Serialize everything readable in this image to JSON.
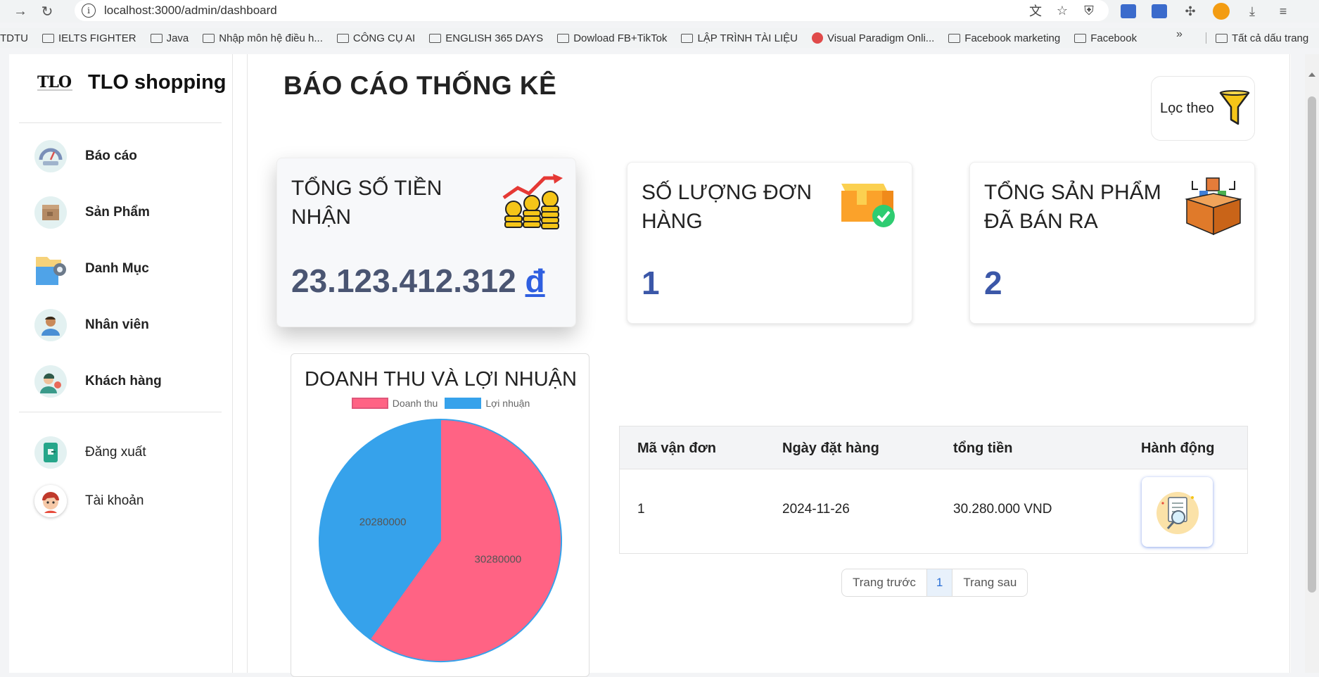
{
  "browser": {
    "url": "localhost:3000/admin/dashboard",
    "bookmarks": [
      "TDTU",
      "IELTS FIGHTER",
      "Java",
      "Nhập môn hệ điều h...",
      "CÔNG CỤ AI",
      "ENGLISH 365 DAYS",
      "Dowload FB+TikTok",
      "LẬP TRÌNH TÀI LIỆU",
      "Visual Paradigm Onli...",
      "Facebook marketing",
      "Facebook"
    ],
    "bookmarks_more": "»",
    "all_bookmarks": "Tất cả dấu trang"
  },
  "sidebar": {
    "brand_logo": "TLO",
    "brand_name": "TLO shopping",
    "items": [
      {
        "label": "Báo cáo",
        "icon": "report-gauge-icon"
      },
      {
        "label": "Sản Phẩm",
        "icon": "product-box-icon"
      },
      {
        "label": "Danh Mục",
        "icon": "category-folder-icon"
      },
      {
        "label": "Nhân viên",
        "icon": "employee-icon"
      },
      {
        "label": "Khách hàng",
        "icon": "customer-icon"
      }
    ],
    "bottom_items": [
      {
        "label": "Đăng xuất",
        "icon": "logout-icon"
      },
      {
        "label": "Tài khoản",
        "icon": "account-avatar-icon"
      }
    ]
  },
  "main": {
    "title": "BÁO CÁO THỐNG KÊ",
    "filter_label": "Lọc theo",
    "cards": [
      {
        "title": "TỔNG SỐ TIỀN NHẬN",
        "value": "23.123.412.312",
        "currency": "đ",
        "icon": "money-growth-icon"
      },
      {
        "title": "SỐ LƯỢNG ĐƠN HÀNG",
        "value": "1",
        "icon": "order-box-check-icon"
      },
      {
        "title": "TỔNG SẢN PHẨM ĐÃ BÁN RA",
        "value": "2",
        "icon": "products-sold-icon"
      }
    ],
    "table": {
      "headers": [
        "Mã vận đơn",
        "Ngày đặt hàng",
        "tổng tiền",
        "Hành động"
      ],
      "rows": [
        {
          "code": "1",
          "date": "2024-11-26",
          "total": "30.280.000 VND",
          "action_icon": "view-document-icon"
        }
      ]
    },
    "pagination": {
      "prev": "Trang trước",
      "current": "1",
      "next": "Trang sau"
    }
  },
  "chart_data": {
    "type": "pie",
    "title": "DOANH THU VÀ LỢI NHUẬN",
    "categories": [
      "Doanh thu",
      "Lợi nhuận"
    ],
    "values": [
      30280000,
      20280000
    ],
    "colors": [
      "#ff6384",
      "#36a2eb"
    ],
    "legend": "top"
  }
}
